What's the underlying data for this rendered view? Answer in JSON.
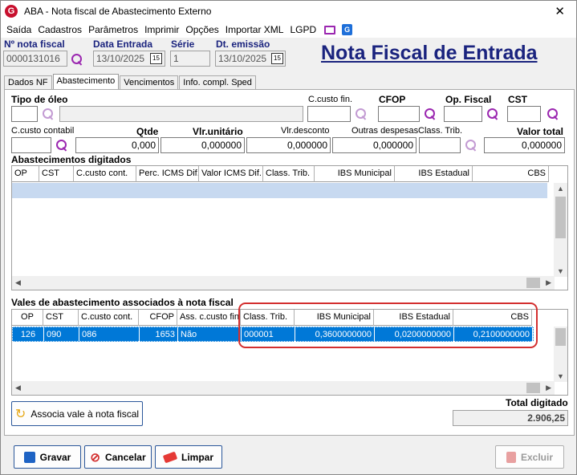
{
  "window": {
    "title": "ABA - Nota fiscal de Abastecimento Externo",
    "close": "✕"
  },
  "menu": [
    "Saída",
    "Cadastros",
    "Parâmetros",
    "Imprimir",
    "Opções",
    "Importar XML",
    "LGPD"
  ],
  "header": {
    "nota_label": "Nº nota fiscal",
    "nota_value": "0000131016",
    "data_entrada_label": "Data Entrada",
    "data_entrada_value": "13/10/2025",
    "serie_label": "Série",
    "serie_value": "1",
    "dt_emissao_label": "Dt. emissão",
    "dt_emissao_value": "13/10/2025",
    "big_title": "Nota Fiscal de Entrada",
    "cal_icon": "15"
  },
  "tabs": [
    "Dados NF",
    "Abastecimento",
    "Vencimentos",
    "Info. compl. Sped"
  ],
  "form": {
    "tipo_oleo_label": "Tipo de óleo",
    "ccusto_fin_label": "C.custo fin.",
    "cfop_label": "CFOP",
    "op_fiscal_label": "Op. Fiscal",
    "cst_label": "CST",
    "ccusto_contabil_label": "C.custo contabil",
    "qtde_label": "Qtde",
    "qtde_value": "0,000",
    "vlr_unitario_label": "Vlr.unitário",
    "vlr_unitario_value": "0,000000",
    "vlr_desconto_label": "Vlr.desconto",
    "vlr_desconto_value": "0,000000",
    "outras_despesas_label": "Outras despesas",
    "outras_despesas_value": "0,000000",
    "class_trib_label": "Class. Trib.",
    "valor_total_label": "Valor total",
    "valor_total_value": "0,000000"
  },
  "abastecimentos": {
    "title": "Abastecimentos digitados",
    "columns": [
      "OP",
      "CST",
      "C.custo cont.",
      "Perc. ICMS Dif.",
      "Valor ICMS Dif.",
      "Class. Trib.",
      "IBS Municipal",
      "IBS Estadual",
      "CBS"
    ]
  },
  "vales": {
    "title": "Vales de abastecimento associados à nota fiscal",
    "columns": [
      "OP",
      "CST",
      "C.custo cont.",
      "CFOP",
      "Ass. c.custo fin.",
      "Class. Trib.",
      "IBS Municipal",
      "IBS Estadual",
      "CBS"
    ],
    "rows": [
      [
        "126",
        "090",
        "086",
        "1653",
        "Não",
        "000001",
        "0,3600000000",
        "0,0200000000",
        "0,2100000000"
      ]
    ]
  },
  "associa_button": "Associa vale à nota fiscal",
  "total_digitado_label": "Total digitado",
  "total_digitado_value": "2.906,25",
  "buttons": {
    "gravar": "Gravar",
    "cancelar": "Cancelar",
    "limpar": "Limpar",
    "excluir": "Excluir"
  },
  "colors": {
    "accent": "#1a237e",
    "selection": "#0078d7",
    "highlight": "#d32f2f",
    "icon_purple": "#9b27b0"
  }
}
